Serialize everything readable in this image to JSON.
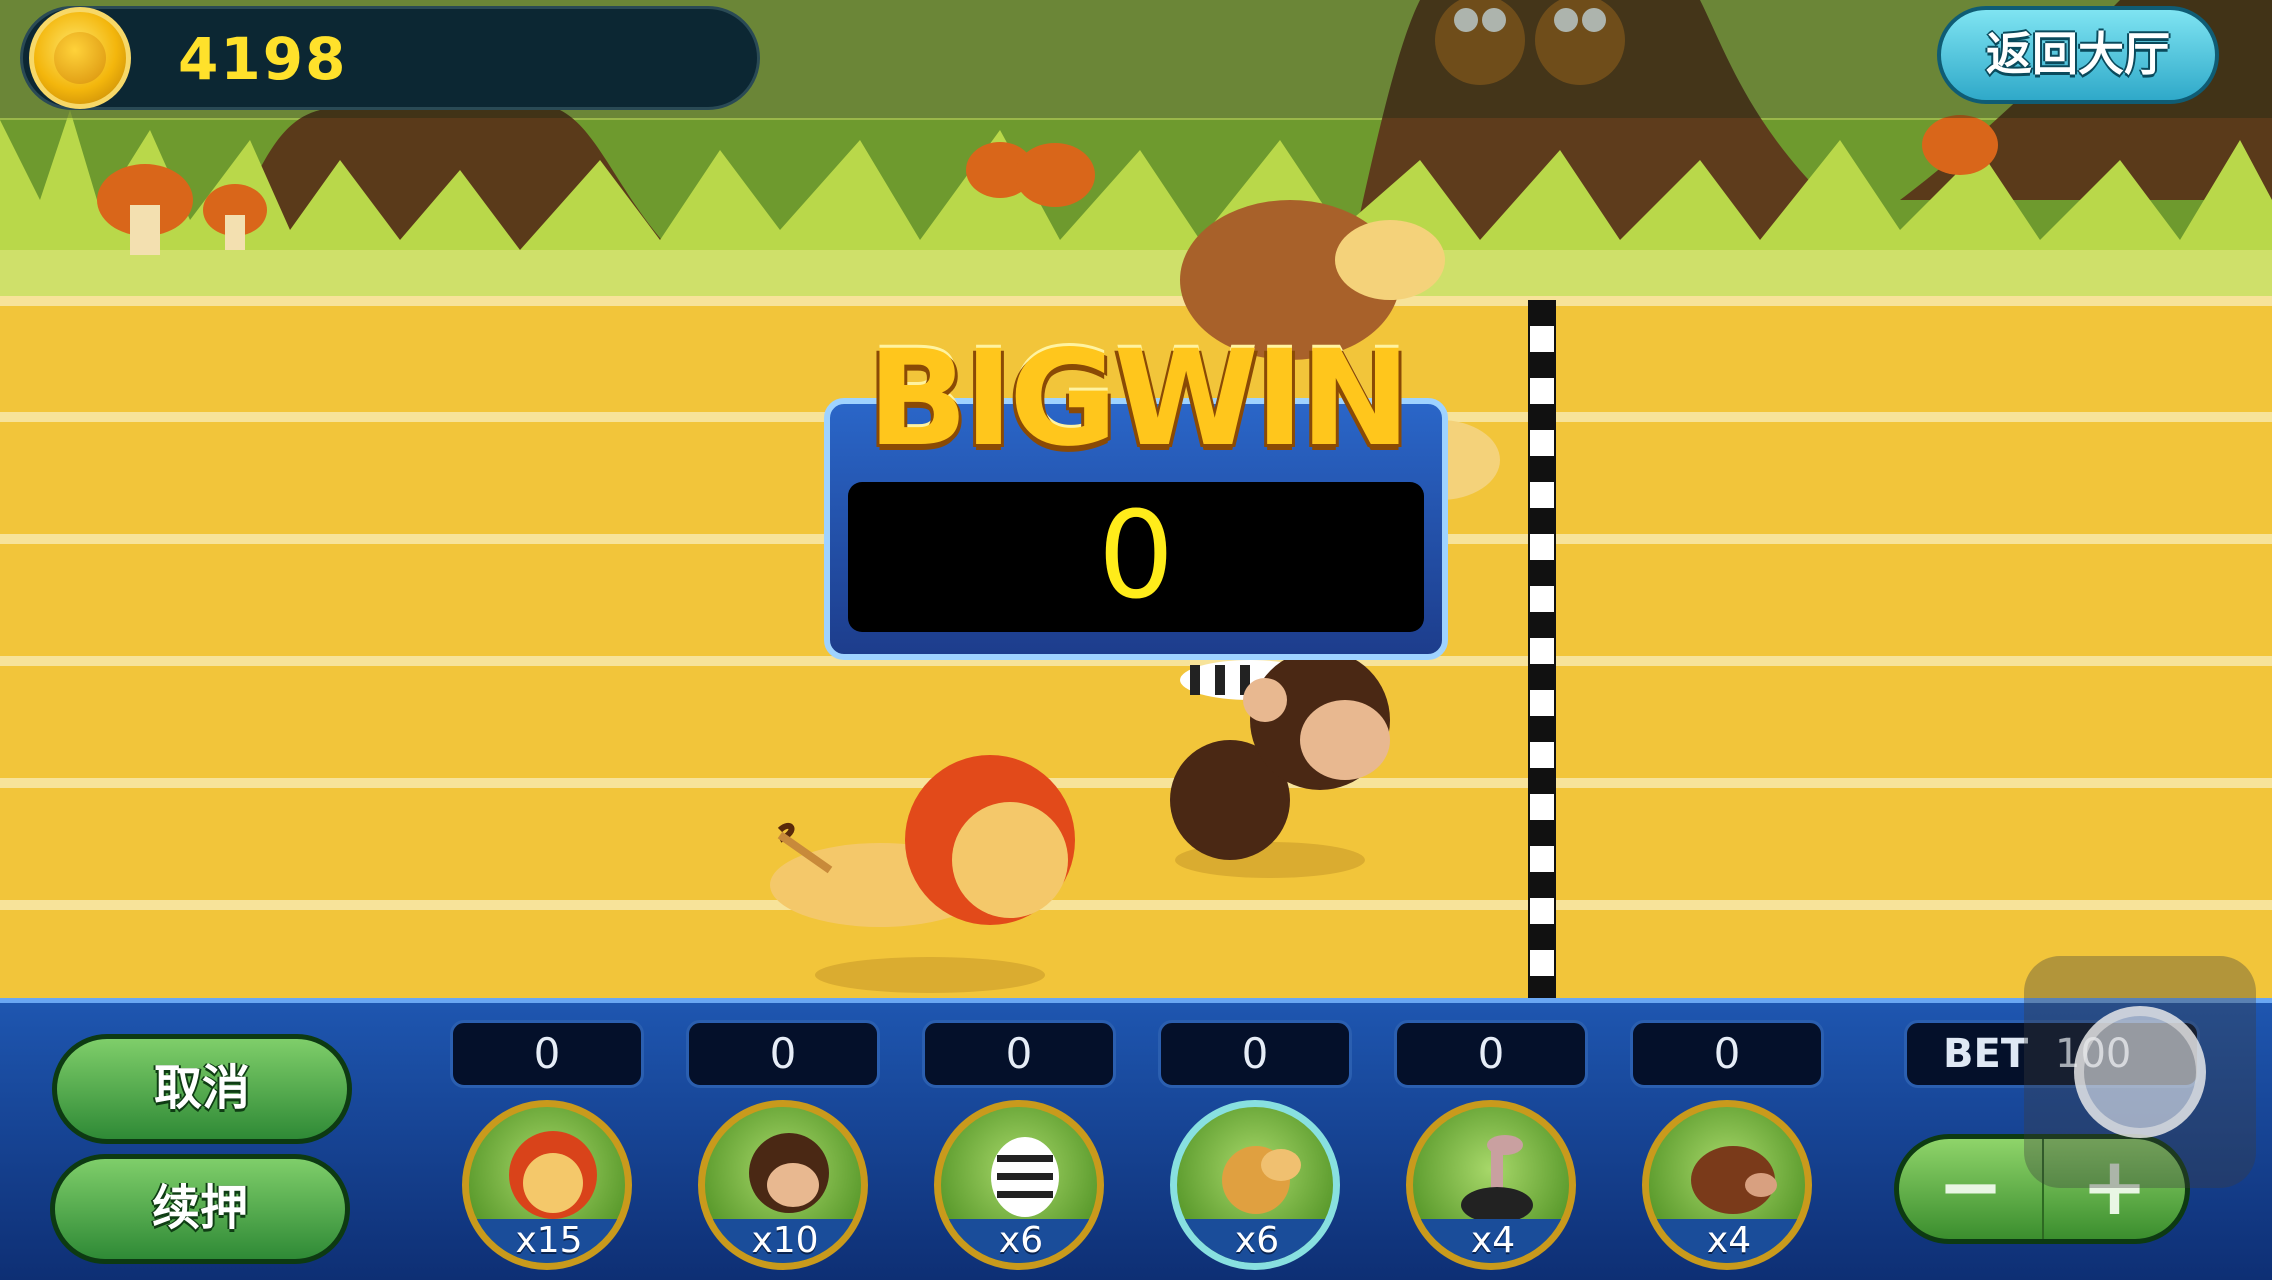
{
  "header": {
    "coin_balance": "4198",
    "lobby_button": "返回大厅"
  },
  "bigwin": {
    "title": "BIGWIN",
    "amount": "0"
  },
  "controls": {
    "cancel_label": "取消",
    "rebet_label": "续押",
    "bet_label": "BET",
    "bet_value": "100",
    "minus_label": "−",
    "plus_label": "+"
  },
  "slots": [
    {
      "animal": "lion",
      "count": "0",
      "multiplier": "x15"
    },
    {
      "animal": "monkey",
      "count": "0",
      "multiplier": "x10"
    },
    {
      "animal": "zebra",
      "count": "0",
      "multiplier": "x6"
    },
    {
      "animal": "camel",
      "count": "0",
      "multiplier": "x6"
    },
    {
      "animal": "ostrich",
      "count": "0",
      "multiplier": "x4"
    },
    {
      "animal": "boar",
      "count": "0",
      "multiplier": "x4"
    }
  ],
  "colors": {
    "track": "#f2c53a",
    "panel": "#1e56b0",
    "coin_text": "#ffe12b",
    "bigwin_gold": "#ffc61c"
  }
}
